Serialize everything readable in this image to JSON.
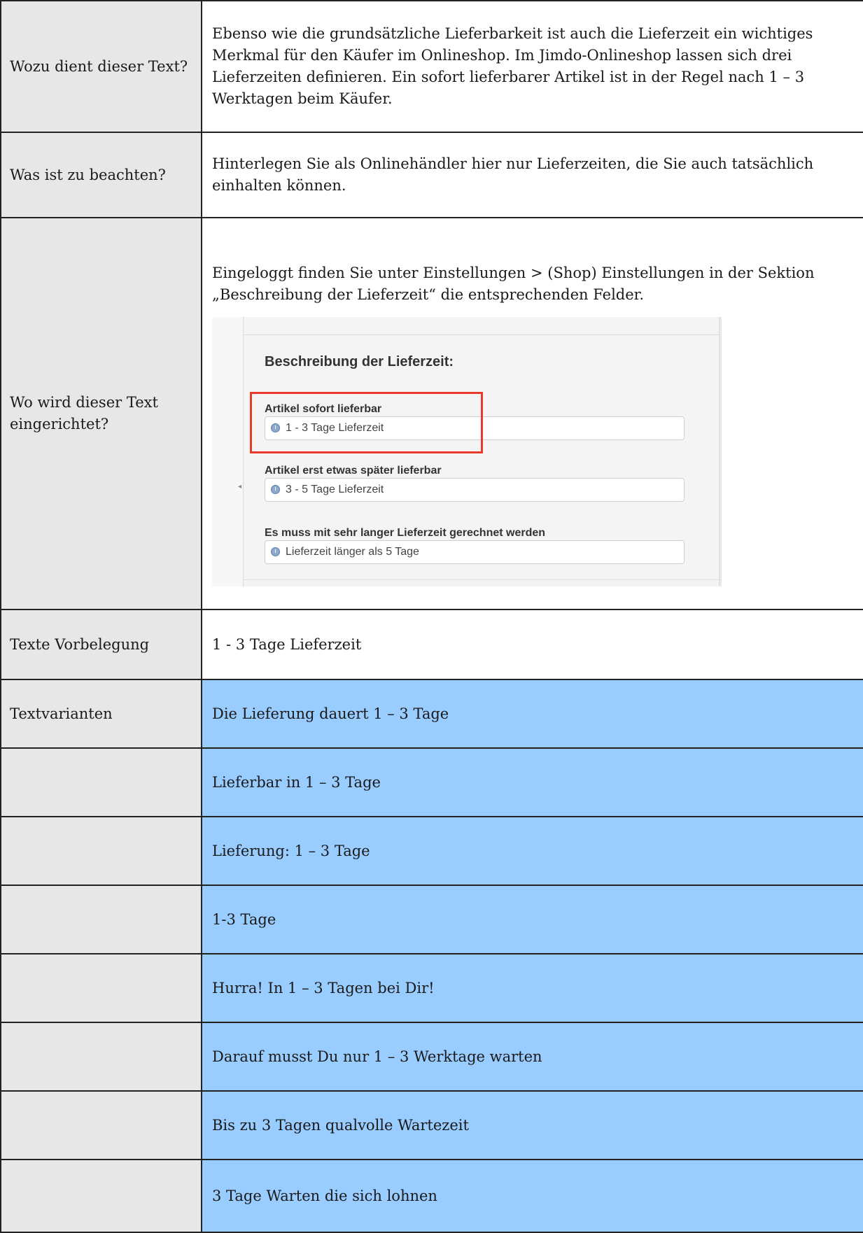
{
  "rows": [
    {
      "label": "Wozu dient dieser Text?",
      "content": "Ebenso wie die grundsätzliche Lieferbarkeit ist auch die Lieferzeit ein wichtiges Merkmal für den Käufer im Onlineshop. Im Jimdo-Onlineshop lassen sich drei Lieferzeiten definieren. Ein sofort lieferbarer Artikel ist in der Regel nach 1 – 3 Werktagen beim Käufer."
    },
    {
      "label": "Was ist zu beachten?",
      "content": "Hinterlegen Sie als Onlinehändler hier nur Lieferzeiten, die Sie auch tatsächlich einhalten können."
    },
    {
      "label": "Wo wird dieser Text eingerichtet?",
      "content": "Eingeloggt finden Sie unter Einstellungen > (Shop) Einstellungen in der Sektion „Beschreibung der Lieferzeit“ die entsprechenden Felder."
    },
    {
      "label": "Texte Vorbelegung",
      "content": "1 - 3 Tage Lieferzeit"
    }
  ],
  "screenshot": {
    "section_title": "Beschreibung der Lieferzeit:",
    "fields": [
      {
        "label": "Artikel sofort lieferbar",
        "value": "1 - 3 Tage Lieferzeit",
        "icon": "clock-icon"
      },
      {
        "label": "Artikel erst etwas später lieferbar",
        "value": "3 - 5 Tage Lieferzeit",
        "icon": "clock-icon"
      },
      {
        "label": "Es muss mit sehr langer Lieferzeit gerechnet werden",
        "value": "Lieferzeit länger als 5 Tage",
        "icon": "clock-icon"
      }
    ],
    "highlight_color": "#e8392a"
  },
  "variants": {
    "label": "Textvarianten",
    "items": [
      "Die Lieferung dauert 1 – 3 Tage",
      "Lieferbar in 1 – 3 Tage",
      "Lieferung: 1 – 3 Tage",
      "1-3 Tage",
      "Hurra! In 1 – 3 Tagen bei Dir!",
      "Darauf musst Du nur 1 – 3 Werktage warten",
      "Bis zu 3 Tagen qualvolle Wartezeit",
      "3 Tage Warten die sich lohnen"
    ],
    "highlight_color": "#99ccff"
  }
}
